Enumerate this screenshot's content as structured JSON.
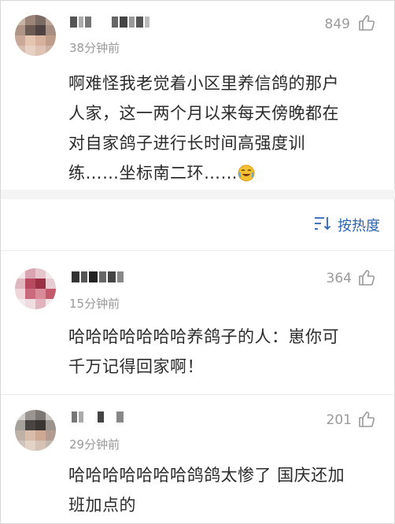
{
  "comments": [
    {
      "likes": "849",
      "time": "38分钟前",
      "lines": [
        "啊难怪我老觉着小区里养信鸽的那户",
        "人家，这一两个月以来每天傍晚都在",
        "对自家鸽子进行长时间高强度训",
        "练……坐标南二环……"
      ],
      "emoji": "laughing-crying-icon"
    },
    {
      "likes": "364",
      "time": "15分钟前",
      "lines": [
        "哈哈哈哈哈哈哈养鸽子的人：崽你可",
        "千万记得回家啊！"
      ]
    },
    {
      "likes": "201",
      "time": "29分钟前",
      "lines": [
        "哈哈哈哈哈哈哈鸽鸽太惨了 国庆还加",
        "班加点的"
      ]
    }
  ],
  "sort": {
    "label": "按热度"
  },
  "colors": {
    "link_blue": "#2d64b3",
    "meta_gray": "#999999",
    "separator": "#f4f4f4"
  }
}
